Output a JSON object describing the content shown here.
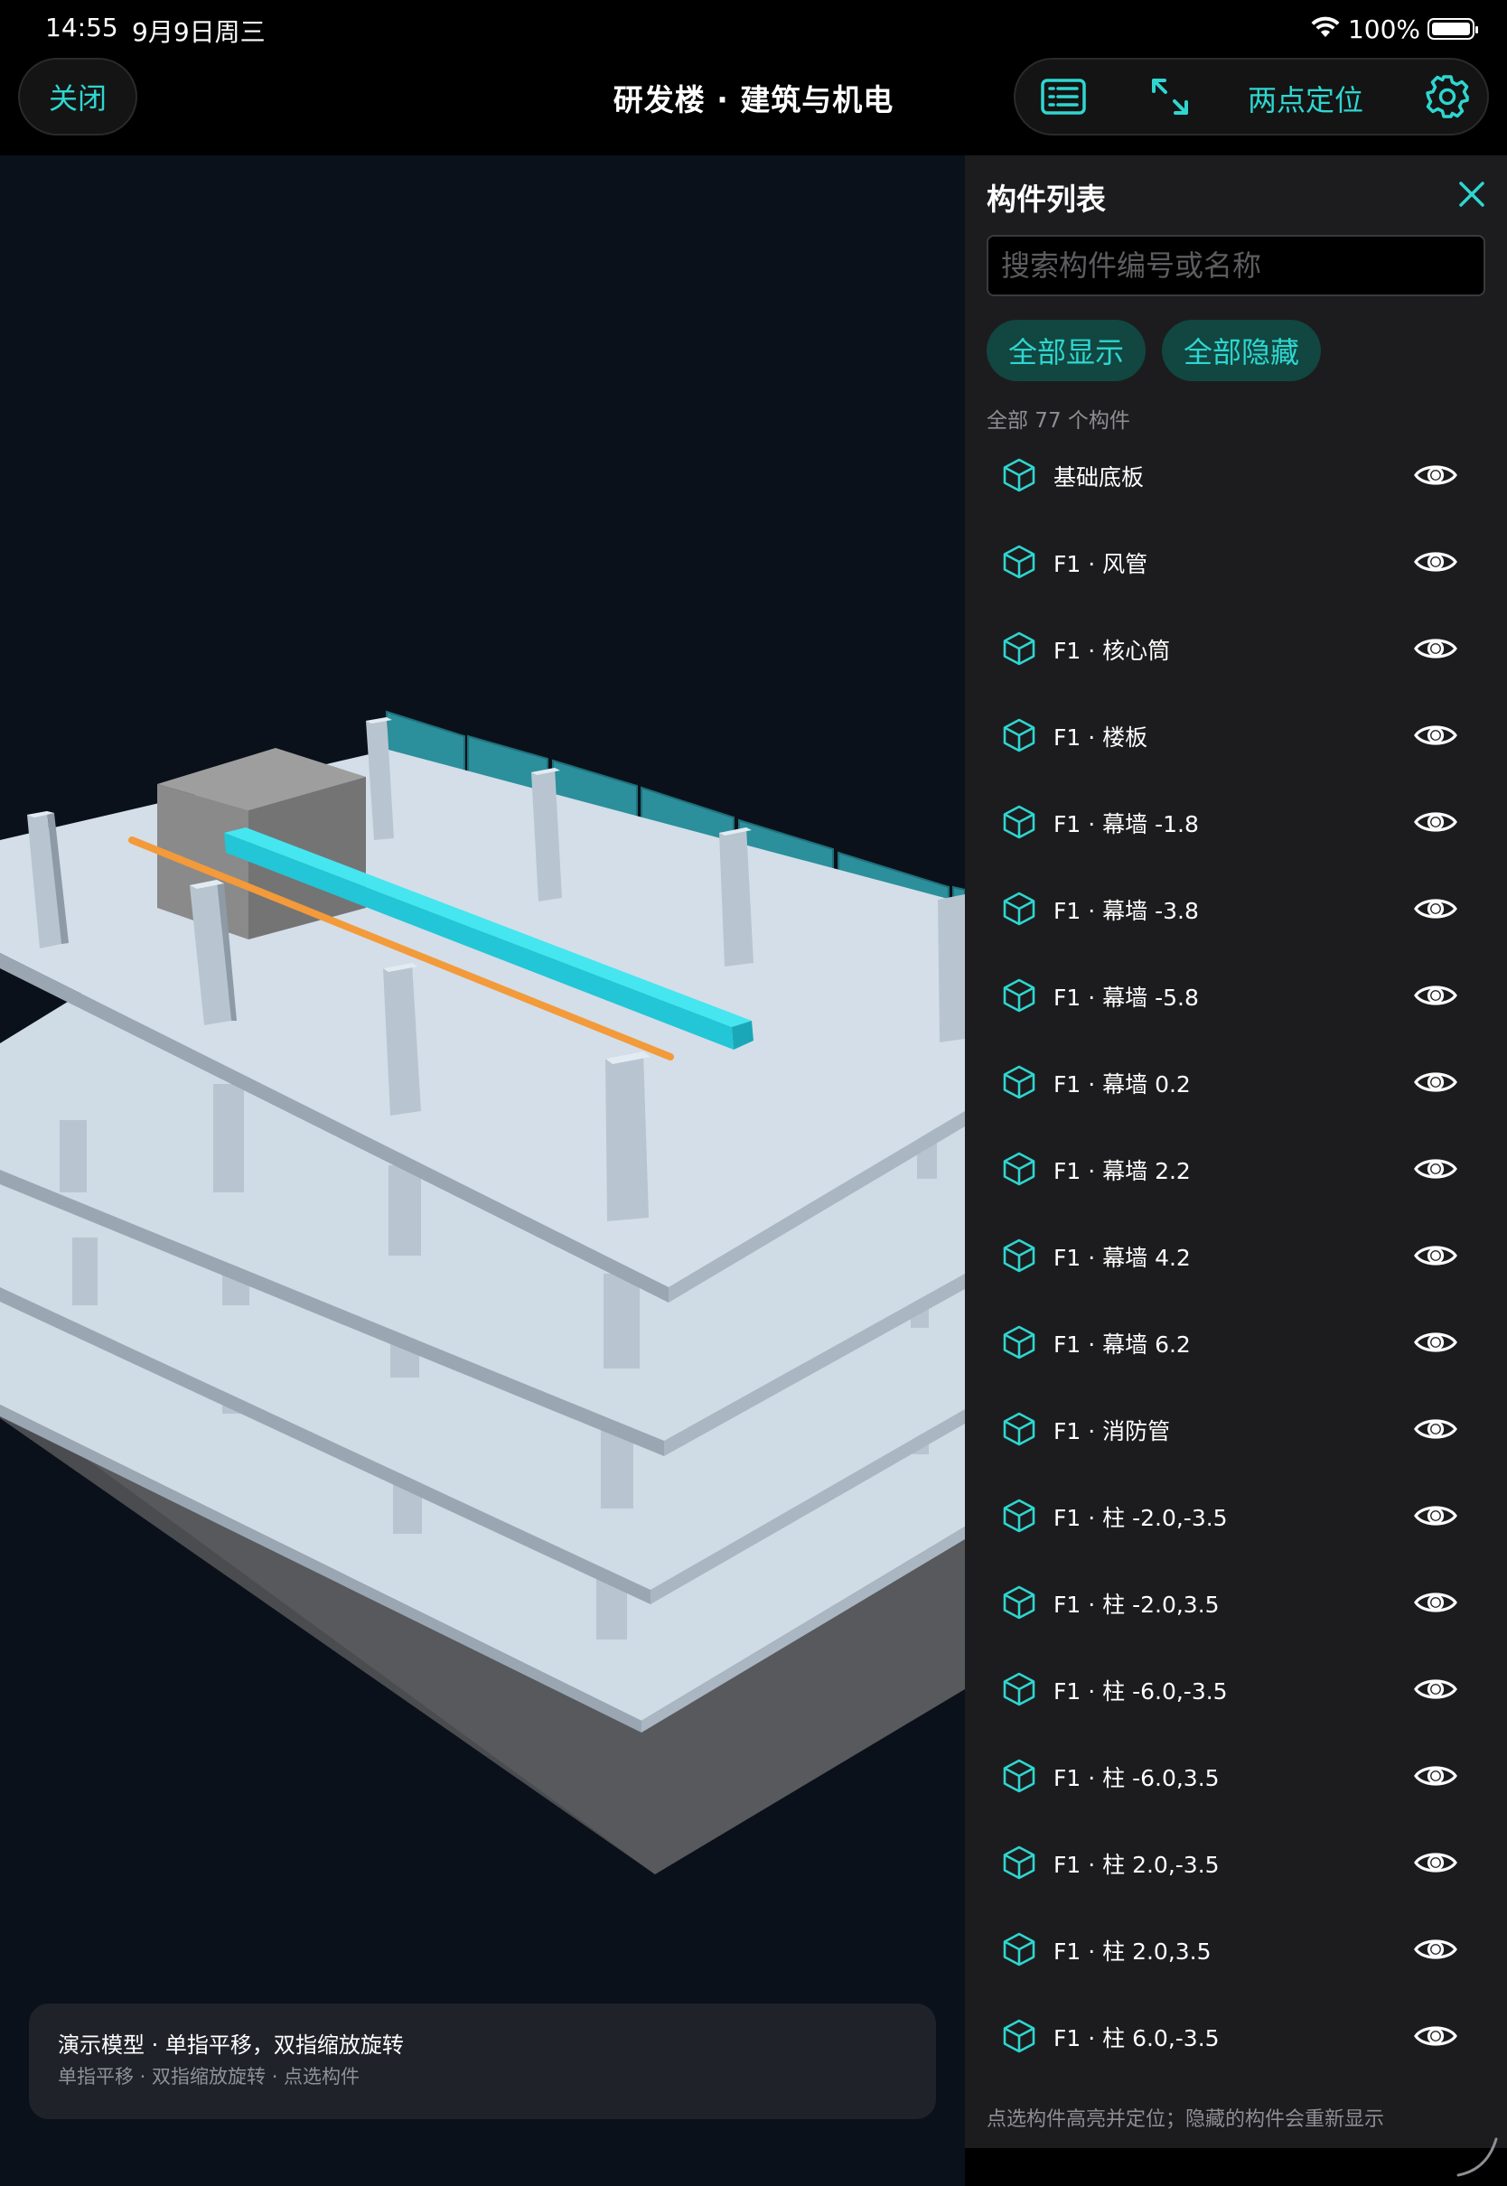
{
  "status_bar": {
    "time": "14:55",
    "date": "9月9日周三",
    "battery": "100%",
    "icons": [
      "wifi-icon",
      "battery-icon"
    ]
  },
  "top_bar": {
    "close_label": "关闭",
    "title": "研发楼 · 建筑与机电",
    "locate_label": "两点定位",
    "icons": [
      "list-icon",
      "expand-icon",
      "gear-icon"
    ]
  },
  "colors": {
    "accent": "#2fd6d0",
    "chip_bg": "#124640",
    "panel_bg": "#1c1c1e",
    "viewport_bg": "#0b111b",
    "duct": "#35dbe6",
    "pipe": "#f39a3a",
    "curtain_wall": "#2b8f9c",
    "slab": "#cfdae4"
  },
  "viewport": {
    "hint_title": "演示模型 · 单指平移，双指缩放旋转",
    "hint_sub": "单指平移 · 双指缩放旋转 · 点选构件"
  },
  "panel": {
    "title": "构件列表",
    "search_placeholder": "搜索构件编号或名称",
    "show_all": "全部显示",
    "hide_all": "全部隐藏",
    "count_text": "全部 77 个构件",
    "footer": "点选构件高亮并定位；隐藏的构件会重新显示",
    "items": [
      {
        "label": "基础底板",
        "visible": true
      },
      {
        "label": "F1 · 风管",
        "visible": true
      },
      {
        "label": "F1 · 核心筒",
        "visible": true
      },
      {
        "label": "F1 · 楼板",
        "visible": true
      },
      {
        "label": "F1 · 幕墙 -1.8",
        "visible": true
      },
      {
        "label": "F1 · 幕墙 -3.8",
        "visible": true
      },
      {
        "label": "F1 · 幕墙 -5.8",
        "visible": true
      },
      {
        "label": "F1 · 幕墙 0.2",
        "visible": true
      },
      {
        "label": "F1 · 幕墙 2.2",
        "visible": true
      },
      {
        "label": "F1 · 幕墙 4.2",
        "visible": true
      },
      {
        "label": "F1 · 幕墙 6.2",
        "visible": true
      },
      {
        "label": "F1 · 消防管",
        "visible": true
      },
      {
        "label": "F1 · 柱 -2.0,-3.5",
        "visible": true
      },
      {
        "label": "F1 · 柱 -2.0,3.5",
        "visible": true
      },
      {
        "label": "F1 · 柱 -6.0,-3.5",
        "visible": true
      },
      {
        "label": "F1 · 柱 -6.0,3.5",
        "visible": true
      },
      {
        "label": "F1 · 柱 2.0,-3.5",
        "visible": true
      },
      {
        "label": "F1 · 柱 2.0,3.5",
        "visible": true
      },
      {
        "label": "F1 · 柱 6.0,-3.5",
        "visible": true
      }
    ]
  }
}
